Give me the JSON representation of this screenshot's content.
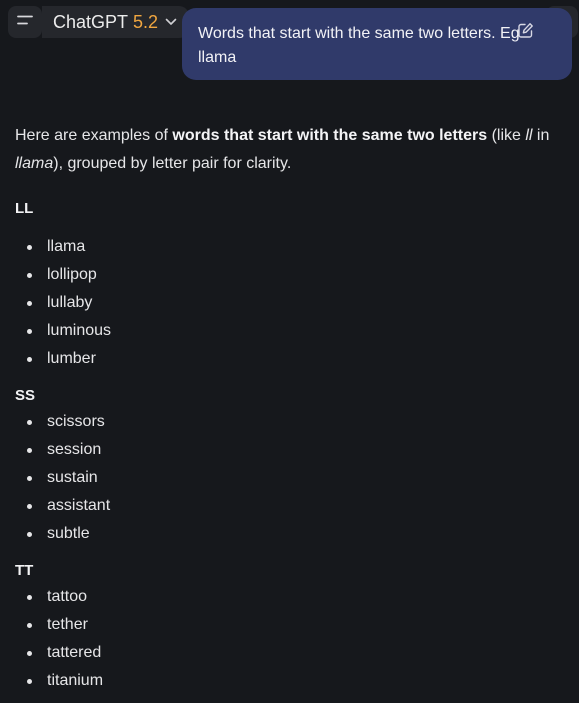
{
  "header": {
    "model_name": "ChatGPT",
    "model_version": "5.2"
  },
  "user_message": {
    "line1": "Words that start with the same two letters. Eg",
    "line2": "llama"
  },
  "response": {
    "intro": {
      "pre": "Here are examples of ",
      "bold": "words that start with the same two letters",
      "mid1": " (like ",
      "em1": "ll",
      "mid2": " in",
      "em2": "llama",
      "post": "), grouped by letter pair for clarity."
    },
    "groups": [
      {
        "heading": "LL",
        "words": [
          "llama",
          "lollipop",
          "lullaby",
          "luminous",
          "lumber"
        ]
      },
      {
        "heading": "SS",
        "words": [
          "scissors",
          "session",
          "sustain",
          "assistant",
          "subtle"
        ]
      },
      {
        "heading": "TT",
        "words": [
          "tattoo",
          "tether",
          "tattered",
          "titanium"
        ]
      }
    ]
  },
  "icons": {
    "menu": "sidebar-menu-icon",
    "chevron": "chevron-down-icon",
    "edit": "edit-pencil-icon",
    "more": "more-dots-icon"
  },
  "colors": {
    "background": "#16181c",
    "user_bubble": "#303a6a",
    "version_accent": "#f0a640"
  }
}
